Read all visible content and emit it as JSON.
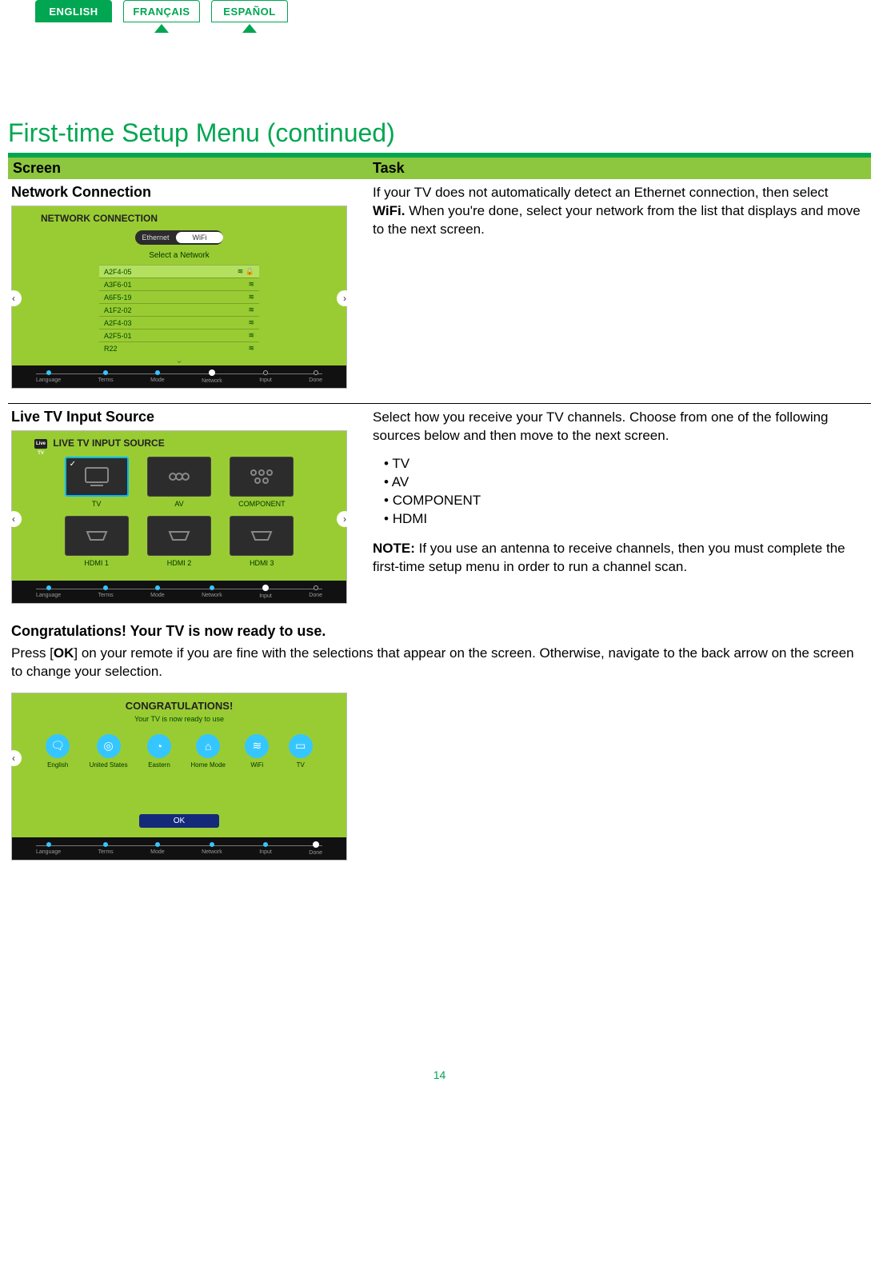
{
  "tabs": {
    "english": "ENGLISH",
    "francais": "FRANÇAIS",
    "espanol": "ESPAÑOL"
  },
  "heading": "First-time Setup Menu (continued)",
  "col": {
    "screen": "Screen",
    "task": "Task"
  },
  "net": {
    "subhead": "Network Connection",
    "shotTitle": "NETWORK CONNECTION",
    "toggle": {
      "off": "Ethernet",
      "on": "WiFi"
    },
    "select": "Select a Network",
    "items": [
      "A2F4-05",
      "A3F6-01",
      "A6F5-19",
      "A1F2-02",
      "A2F4-03",
      "A2F5-01",
      "R22"
    ],
    "taskHtml": "If your TV does not automatically detect an Ethernet connection, then select <b>WiFi.</b> When you're done, select your network from the list that displays and move to the next screen."
  },
  "src": {
    "subhead": "Live TV Input Source",
    "shotTitle": "LIVE TV INPUT SOURCE",
    "items": [
      "TV",
      "AV",
      "COMPONENT",
      "HDMI 1",
      "HDMI 2",
      "HDMI 3"
    ],
    "taskIntro": "Select how you receive your TV channels. Choose from one of the following sources below and then move to the next screen.",
    "bullets": [
      "TV",
      "AV",
      "COMPONENT",
      "HDMI"
    ],
    "noteLabel": "NOTE:",
    "noteText": " If you use an antenna to receive channels, then you must complete the first-time setup menu in order to run a channel scan."
  },
  "congrats": {
    "subhead": "Congratulations! Your TV is now ready to use.",
    "para": "Press [<b>OK</b>] on your remote if you are fine with the selections that appear on the screen. Otherwise, navigate to the back arrow on the screen to change your selection.",
    "shotTitle": "CONGRATULATIONS!",
    "shotSub": "Your TV is now ready to use",
    "icons": [
      {
        "icon": "🗨",
        "label": "English"
      },
      {
        "icon": "◎",
        "label": "United States"
      },
      {
        "icon": "◔",
        "label": "Eastern"
      },
      {
        "icon": "⌂",
        "label": "Home Mode"
      },
      {
        "icon": "≋",
        "label": "WiFi"
      },
      {
        "icon": "▭",
        "label": "TV"
      }
    ],
    "ok": "OK"
  },
  "steps": [
    "Language",
    "Terms",
    "Mode",
    "Network",
    "Input",
    "Done"
  ],
  "pagenum": "14"
}
